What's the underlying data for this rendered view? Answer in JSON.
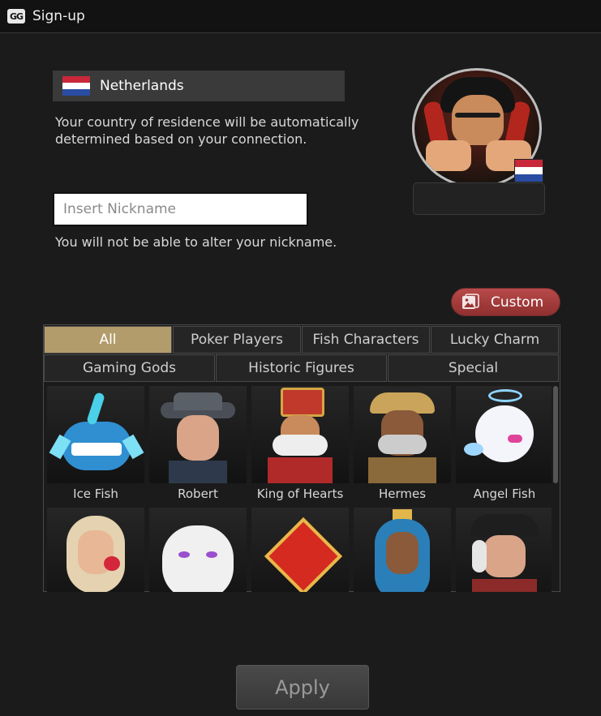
{
  "window": {
    "logo": "GG",
    "title": "Sign-up"
  },
  "country": {
    "name": "Netherlands",
    "note": "Your country of residence will be automatically determined based on your connection.",
    "flag_colors": [
      "#c8283a",
      "#ffffff",
      "#2a4da3"
    ]
  },
  "nickname": {
    "value": "",
    "placeholder": "Insert Nickname",
    "note": "You will not be able to alter your nickname."
  },
  "custom_button": {
    "label": "Custom",
    "icon": "image-icon"
  },
  "tabs": {
    "row1": [
      {
        "label": "All",
        "active": true
      },
      {
        "label": "Poker Players",
        "active": false
      },
      {
        "label": "Fish Characters",
        "active": false
      },
      {
        "label": "Lucky Charm",
        "active": false
      }
    ],
    "row2": [
      {
        "label": "Gaming Gods",
        "active": false
      },
      {
        "label": "Historic Figures",
        "active": false
      },
      {
        "label": "Special",
        "active": false
      }
    ]
  },
  "avatars": [
    {
      "label": "Ice Fish",
      "icon": "ice-fish-icon"
    },
    {
      "label": "Robert",
      "icon": "robert-icon"
    },
    {
      "label": "King of Hearts",
      "icon": "king-of-hearts-icon"
    },
    {
      "label": "Hermes",
      "icon": "hermes-icon"
    },
    {
      "label": "Angel Fish",
      "icon": "angel-fish-icon"
    },
    {
      "label": "",
      "icon": "goddess-avatar-icon"
    },
    {
      "label": "",
      "icon": "white-cat-avatar-icon"
    },
    {
      "label": "",
      "icon": "lucky-charm-avatar-icon"
    },
    {
      "label": "",
      "icon": "queen-avatar-icon"
    },
    {
      "label": "",
      "icon": "pirate-avatar-icon"
    }
  ],
  "apply_button": {
    "label": "Apply"
  },
  "colors": {
    "active_tab": "#b39c6b",
    "custom_button": "#a83f3f",
    "background": "#1b1b1b"
  }
}
